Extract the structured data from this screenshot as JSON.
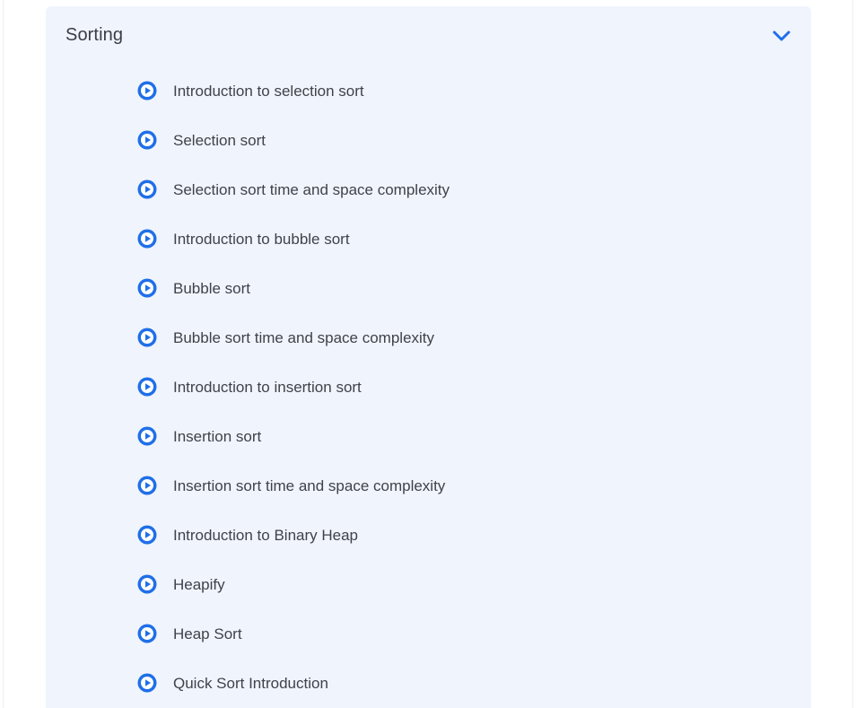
{
  "section": {
    "title": "Sorting",
    "expand_icon": "chevron-down-icon",
    "accent_color": "#1f6fe8",
    "background_color": "#f0f4fd"
  },
  "lessons": [
    {
      "label": "Introduction to selection sort",
      "icon": "play-circle-icon"
    },
    {
      "label": "Selection sort",
      "icon": "play-circle-icon"
    },
    {
      "label": "Selection sort time and space complexity",
      "icon": "play-circle-icon"
    },
    {
      "label": "Introduction to bubble sort",
      "icon": "play-circle-icon"
    },
    {
      "label": "Bubble sort",
      "icon": "play-circle-icon"
    },
    {
      "label": "Bubble sort time and space complexity",
      "icon": "play-circle-icon"
    },
    {
      "label": "Introduction to insertion sort",
      "icon": "play-circle-icon"
    },
    {
      "label": "Insertion sort",
      "icon": "play-circle-icon"
    },
    {
      "label": "Insertion sort time and space complexity",
      "icon": "play-circle-icon"
    },
    {
      "label": "Introduction to Binary Heap",
      "icon": "play-circle-icon"
    },
    {
      "label": "Heapify",
      "icon": "play-circle-icon"
    },
    {
      "label": "Heap Sort",
      "icon": "play-circle-icon"
    },
    {
      "label": "Quick Sort Introduction",
      "icon": "play-circle-icon"
    }
  ]
}
